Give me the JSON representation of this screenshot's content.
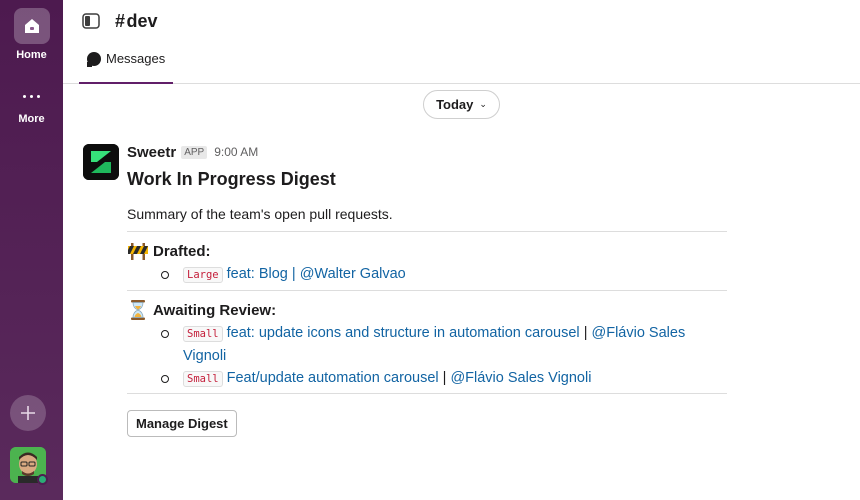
{
  "rail": {
    "home_label": "Home",
    "more_label": "More"
  },
  "header": {
    "channel_prefix": "#",
    "channel_name": "dev",
    "tab_label": "Messages"
  },
  "day_divider": {
    "label": "Today"
  },
  "message": {
    "sender": "Sweetr",
    "badge": "APP",
    "time": "9:00 AM",
    "title": "Work In Progress Digest",
    "summary": "Summary of the team's open pull requests.",
    "sections": [
      {
        "heading": "Drafted:",
        "emoji": "construction-icon",
        "items": [
          {
            "size": "Large",
            "title": "feat: Blog",
            "sep": " | ",
            "author": "@Walter Galvao"
          }
        ]
      },
      {
        "heading": "Awaiting Review:",
        "emoji": "hourglass-icon",
        "items": [
          {
            "size": "Small",
            "title": "feat: update icons and structure in automation carousel",
            "sep": " | ",
            "author": "@Flávio Sales Vignoli"
          },
          {
            "size": "Small",
            "title": "Feat/update automation carousel",
            "sep": " | ",
            "author": "@Flávio Sales Vignoli"
          }
        ]
      }
    ],
    "button_label": "Manage Digest"
  },
  "colors": {
    "rail": "#4a154b",
    "link": "#1264a3",
    "code": "#c41e3a",
    "brand": "#2ee67a"
  }
}
